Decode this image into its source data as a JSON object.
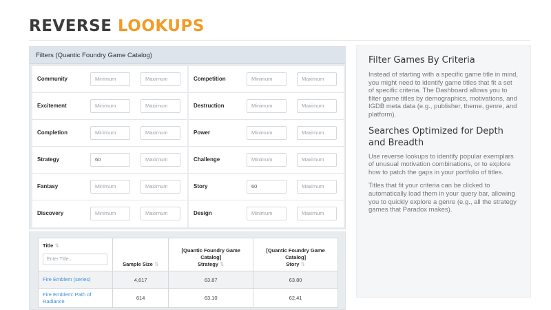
{
  "header": {
    "title_part1": "REVERSE",
    "title_part2": "LOOKUPS"
  },
  "filters": {
    "heading": "Filters (Quantic Foundry Game Catalog)",
    "min_placeholder": "Minimum",
    "max_placeholder": "Maximum",
    "left": [
      {
        "label": "Community",
        "min": "",
        "max": ""
      },
      {
        "label": "Excitement",
        "min": "",
        "max": ""
      },
      {
        "label": "Completion",
        "min": "",
        "max": ""
      },
      {
        "label": "Strategy",
        "min": "60",
        "max": ""
      },
      {
        "label": "Fantasy",
        "min": "",
        "max": ""
      },
      {
        "label": "Discovery",
        "min": "",
        "max": ""
      }
    ],
    "right": [
      {
        "label": "Competition",
        "min": "",
        "max": ""
      },
      {
        "label": "Destruction",
        "min": "",
        "max": ""
      },
      {
        "label": "Power",
        "min": "",
        "max": ""
      },
      {
        "label": "Challenge",
        "min": "",
        "max": ""
      },
      {
        "label": "Story",
        "min": "60",
        "max": ""
      },
      {
        "label": "Design",
        "min": "",
        "max": ""
      }
    ]
  },
  "results": {
    "columns": [
      {
        "label": "Title",
        "sort": "⇅"
      },
      {
        "label": "Sample Size",
        "sort": "⇅"
      },
      {
        "label": "[Quantic Foundry Game Catalog] Strategy",
        "line1": "[Quantic Foundry Game",
        "line2": "Catalog]",
        "line3": "Strategy",
        "sort": "⇅"
      },
      {
        "label": "[Quantic Foundry Game Catalog] Story",
        "line1": "[Quantic Foundry Game",
        "line2": "Catalog]",
        "line3": "Story",
        "sort": "⇅"
      }
    ],
    "title_filter_placeholder": "Enter Title...",
    "rows": [
      {
        "title": "Fire Emblem (series)",
        "sample_size": "4,617",
        "strategy": "63.87",
        "story": "63.80"
      },
      {
        "title": "Fire Emblem: Path of Radiance",
        "sample_size": "614",
        "strategy": "63.10",
        "story": "62.41"
      }
    ]
  },
  "info": {
    "heading1": "Filter Games By Criteria",
    "para1": "Instead of starting with a specific game title in mind, you might need to identify game titles that fit a set of specific criteria. The Dashboard allows you to filter game titles by demographics, motivations, and IGDB meta data (e.g., publisher, theme, genre, and platform).",
    "heading2": "Searches Optimized for Depth and Breadth",
    "para2": "Use reverse lookups to identify popular exemplars of unusual motivation combinations, or to explore how to patch the gaps in your portfolio of titles.",
    "para3": "Titles that fit your criteria can be clicked to automatically load them in your query bar, allowing you to quickly explore a genre (e.g., all the strategy games that Paradox makes)."
  },
  "colors": {
    "accent_orange": "#f29b26",
    "title_dark": "#3b3b3b",
    "link_blue": "#3a8fd9",
    "panel_header": "#dde4ec"
  }
}
